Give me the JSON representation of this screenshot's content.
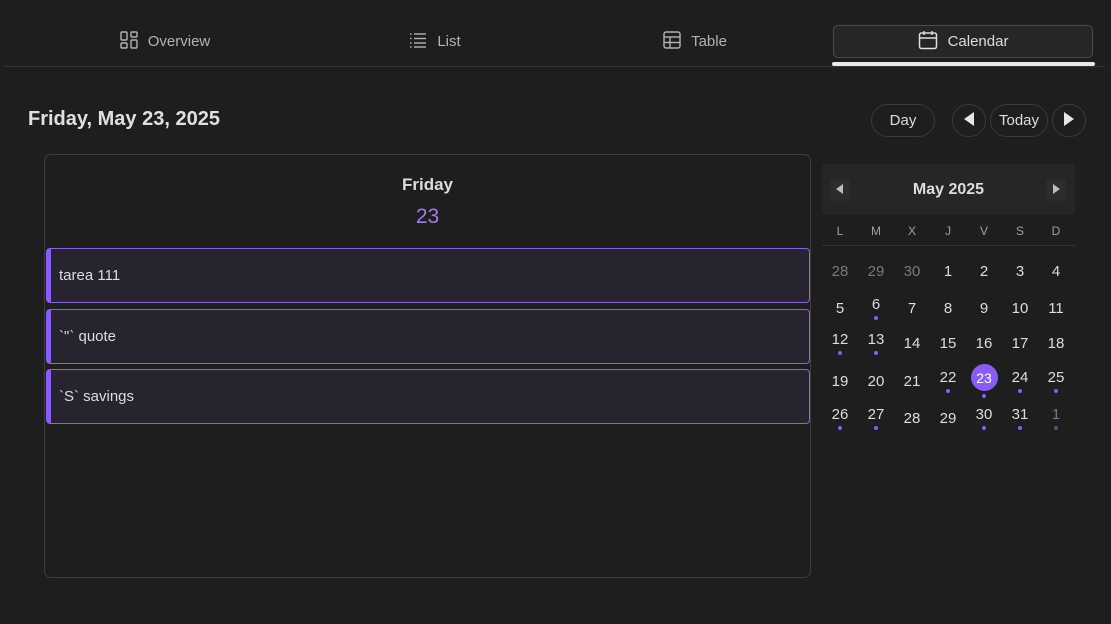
{
  "tabs": [
    {
      "label": "Overview",
      "icon": "overview-icon"
    },
    {
      "label": "List",
      "icon": "list-icon"
    },
    {
      "label": "Table",
      "icon": "table-icon"
    },
    {
      "label": "Calendar",
      "icon": "calendar-icon",
      "active": true
    }
  ],
  "header": {
    "date_title": "Friday, May 23, 2025",
    "view_button": "Day",
    "today_button": "Today"
  },
  "day_view": {
    "day_name": "Friday",
    "day_number": "23",
    "events": [
      "tarea 111",
      "`\"` quote",
      "`S` savings"
    ]
  },
  "mini_calendar": {
    "title": "May 2025",
    "weekdays": [
      "L",
      "M",
      "X",
      "J",
      "V",
      "S",
      "D"
    ],
    "weeks": [
      [
        {
          "d": "28",
          "o": true
        },
        {
          "d": "29",
          "o": true
        },
        {
          "d": "30",
          "o": true
        },
        {
          "d": "1"
        },
        {
          "d": "2"
        },
        {
          "d": "3"
        },
        {
          "d": "4"
        }
      ],
      [
        {
          "d": "5"
        },
        {
          "d": "6",
          "dot": true
        },
        {
          "d": "7"
        },
        {
          "d": "8"
        },
        {
          "d": "9"
        },
        {
          "d": "10"
        },
        {
          "d": "11"
        }
      ],
      [
        {
          "d": "12",
          "dot": true
        },
        {
          "d": "13",
          "dot": true
        },
        {
          "d": "14"
        },
        {
          "d": "15"
        },
        {
          "d": "16"
        },
        {
          "d": "17"
        },
        {
          "d": "18"
        }
      ],
      [
        {
          "d": "19"
        },
        {
          "d": "20"
        },
        {
          "d": "21"
        },
        {
          "d": "22",
          "dot": true
        },
        {
          "d": "23",
          "dot": true,
          "sel": true
        },
        {
          "d": "24",
          "dot": true
        },
        {
          "d": "25",
          "dot": true
        }
      ],
      [
        {
          "d": "26",
          "dot": true
        },
        {
          "d": "27",
          "dot": true
        },
        {
          "d": "28"
        },
        {
          "d": "29"
        },
        {
          "d": "30",
          "dot": true
        },
        {
          "d": "31",
          "dot": true
        },
        {
          "d": "1",
          "o": true,
          "dot": true
        }
      ]
    ]
  },
  "colors": {
    "accent": "#8a5cf6",
    "background": "#1e1e1e"
  }
}
